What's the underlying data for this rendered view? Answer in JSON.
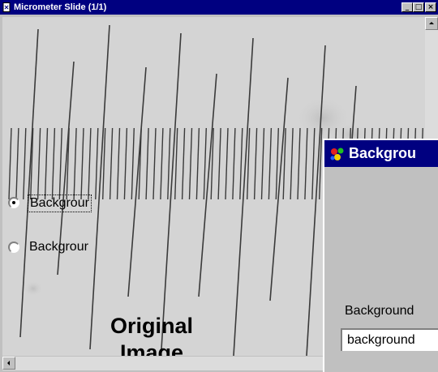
{
  "window": {
    "title": "Micrometer Slide (1/1)",
    "minimize_glyph": "_",
    "maximize_glyph": "□",
    "close_glyph": "×"
  },
  "image": {
    "overlay_label_line1": "Original",
    "overlay_label_line2": "Image",
    "icon": "micrometer-scale-image"
  },
  "dialog": {
    "title": "Backgrou",
    "option_1_label": "Backgrour",
    "option_1_selected": true,
    "option_2_label": "Backgrour",
    "option_2_selected": false,
    "field_label": "Background",
    "field_value": "background"
  },
  "colors": {
    "titlebar": "#000080",
    "face": "#c0c0c0",
    "image_background": "#d4d4d4"
  }
}
